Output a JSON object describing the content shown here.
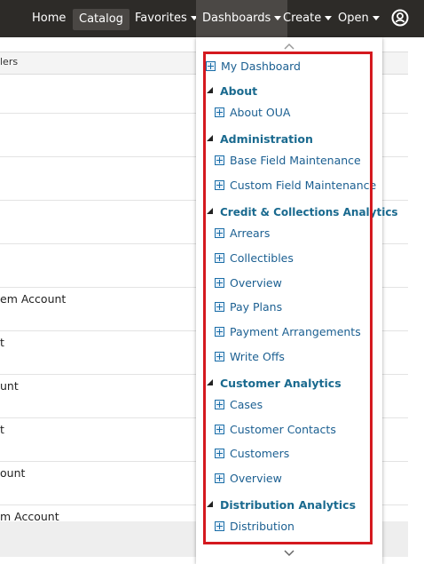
{
  "nav": {
    "home": "Home",
    "catalog": "Catalog",
    "favorites": "Favorites",
    "dashboards": "Dashboards",
    "create": "Create",
    "open": "Open",
    "user_icon": "user-circle-icon"
  },
  "background": {
    "header_text": "lers",
    "rows": [
      "em Account",
      "t",
      "unt",
      "t",
      "ount",
      "m Account"
    ]
  },
  "dropdown": {
    "my_dashboard": "My Dashboard",
    "groups": [
      {
        "label": "About",
        "items": [
          "About OUA"
        ]
      },
      {
        "label": "Administration",
        "items": [
          "Base Field Maintenance",
          "Custom Field Maintenance"
        ]
      },
      {
        "label": "Credit & Collections Analytics",
        "items": [
          "Arrears",
          "Collectibles",
          "Overview",
          "Pay Plans",
          "Payment Arrangements",
          "Write Offs"
        ]
      },
      {
        "label": "Customer Analytics",
        "items": [
          "Cases",
          "Customer Contacts",
          "Customers",
          "Overview"
        ]
      },
      {
        "label": "Distribution Analytics",
        "items": [
          "Distribution"
        ]
      }
    ]
  },
  "colors": {
    "nav_bg": "#2d2b28",
    "link_blue": "#1b5f91",
    "group_teal": "#1a6a8f",
    "highlight_red": "#d4191f"
  }
}
